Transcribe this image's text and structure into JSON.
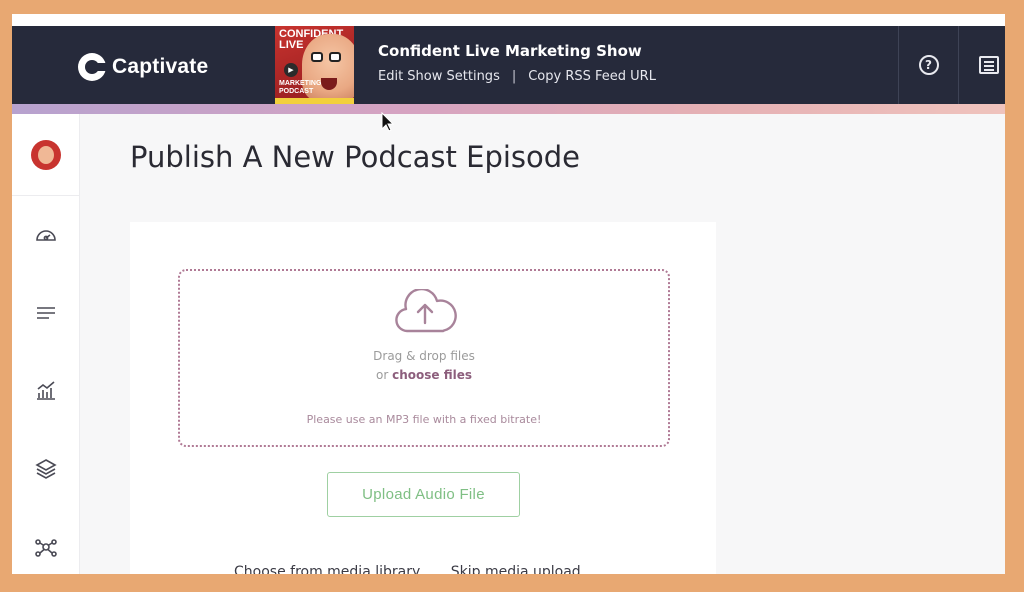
{
  "brand": {
    "name": "Captivate"
  },
  "show": {
    "title": "Confident Live Marketing Show",
    "cover_text_top": "CONFIDENT LIVE",
    "cover_text_bottom": "MARKETING PODCAST",
    "links": [
      "Edit Show Settings",
      "Copy RSS Feed URL"
    ],
    "separator": "|"
  },
  "header_buttons": {
    "help_icon": "question-circle-icon",
    "menu_icon": "list-icon"
  },
  "sidebar": {
    "avatar": "user-avatar",
    "items": [
      {
        "icon": "dashboard-gauge-icon"
      },
      {
        "icon": "menu-lines-icon"
      },
      {
        "icon": "analytics-chart-icon"
      },
      {
        "icon": "layers-icon"
      },
      {
        "icon": "network-nodes-icon"
      }
    ]
  },
  "page": {
    "title": "Publish A New Podcast Episode"
  },
  "upload": {
    "drag_text": "Drag & drop files",
    "or_text": "or",
    "choose_text": "choose files",
    "hint": "Please use an MP3 file with a fixed bitrate!",
    "button_label": "Upload Audio File",
    "alt_link_1": "Choose from media library",
    "alt_link_2": "Skip media upload"
  },
  "colors": {
    "header_bg": "#262a3b",
    "accent_mauve": "#8c5e7c",
    "upload_green": "#7fbf84",
    "frame_bg": "#e8a872"
  }
}
